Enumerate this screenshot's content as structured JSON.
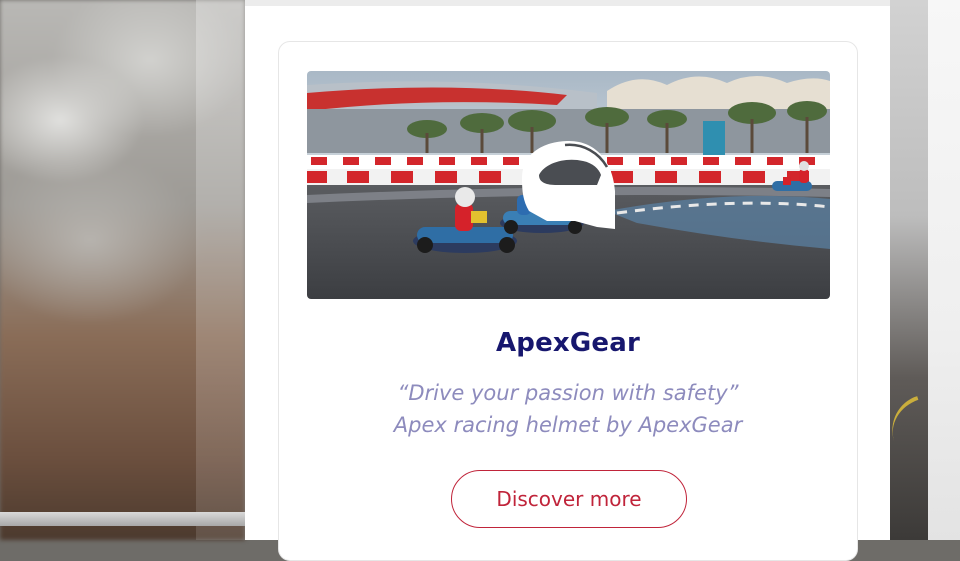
{
  "product": {
    "brand": "ApexGear",
    "tagline": "“Drive your passion with safety”",
    "subtitle": "Apex racing helmet by ApexGear",
    "cta_label": "Discover more",
    "hero_icon": "helmet-icon",
    "hero_scene": "go-kart race track photo"
  },
  "colors": {
    "title": "#17176e",
    "text_muted": "#8d8bbd",
    "accent": "#c0243a"
  }
}
